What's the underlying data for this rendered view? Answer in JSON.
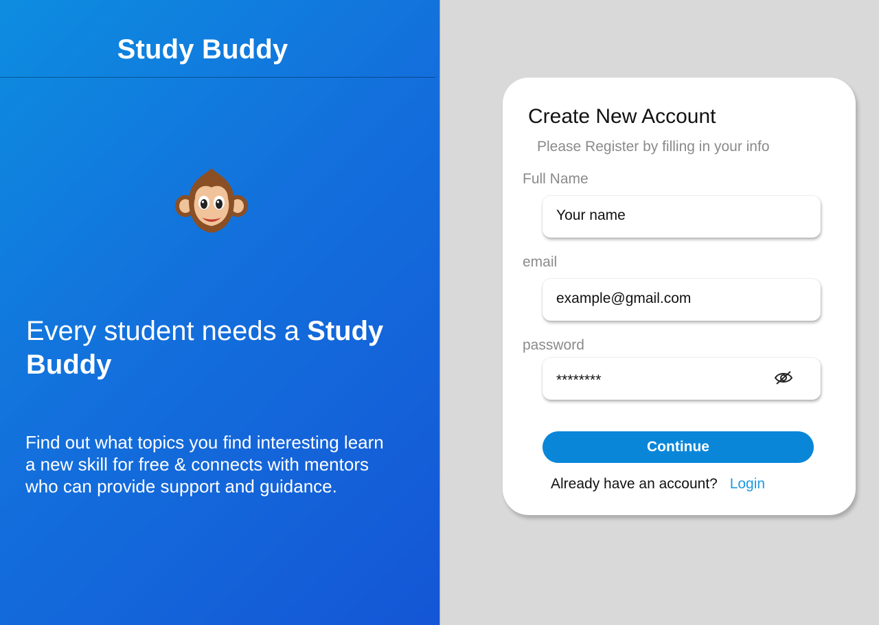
{
  "brand": {
    "title": "Study Buddy"
  },
  "hero": {
    "tagline_prefix": "Every student needs a ",
    "tagline_bold": "Study Buddy",
    "description": "Find out what topics you find interesting learn a new skill for free & connects with mentors who can provide support and guidance."
  },
  "form": {
    "title": "Create New Account",
    "subtitle": "Please Register by filling in your info",
    "fields": [
      {
        "label": "Full Name",
        "value": "Your name"
      },
      {
        "label": "email",
        "value": "example@gmail.com"
      },
      {
        "label": "password",
        "value": "********"
      }
    ],
    "continue_label": "Continue",
    "login_prompt": "Already have an account?",
    "login_link": "Login"
  },
  "icons": {
    "mascot": "monkey-face-icon",
    "password_toggle": "eye-slash-icon"
  },
  "colors": {
    "gradient_start": "#0d8de0",
    "gradient_end": "#1456d6",
    "accent_button": "#0a86d9",
    "link": "#1d9ae0",
    "background": "#d9d9d9"
  }
}
